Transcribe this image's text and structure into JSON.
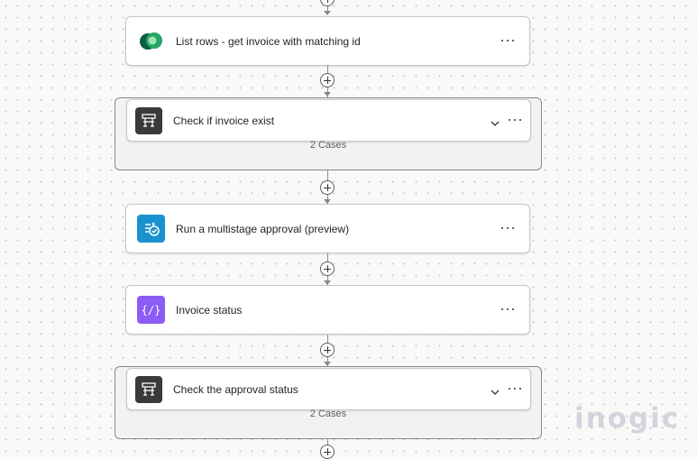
{
  "flow": {
    "steps": [
      {
        "title": "List rows - get invoice with matching id",
        "icon": "dataverse-icon",
        "color": "#0b5e3f"
      },
      {
        "title": "Check if invoice exist",
        "icon": "switch-icon",
        "color": "#3b3a39",
        "cases": "2 Cases"
      },
      {
        "title": "Run a multistage approval (preview)",
        "icon": "approval-icon",
        "color": "#1b91cf"
      },
      {
        "title": "Invoice status",
        "icon": "variable-icon",
        "color": "#8b5cf6"
      },
      {
        "title": "Check the approval status",
        "icon": "switch-icon",
        "color": "#3b3a39",
        "cases": "2 Cases"
      }
    ]
  },
  "watermark": {
    "text": "inogic"
  }
}
